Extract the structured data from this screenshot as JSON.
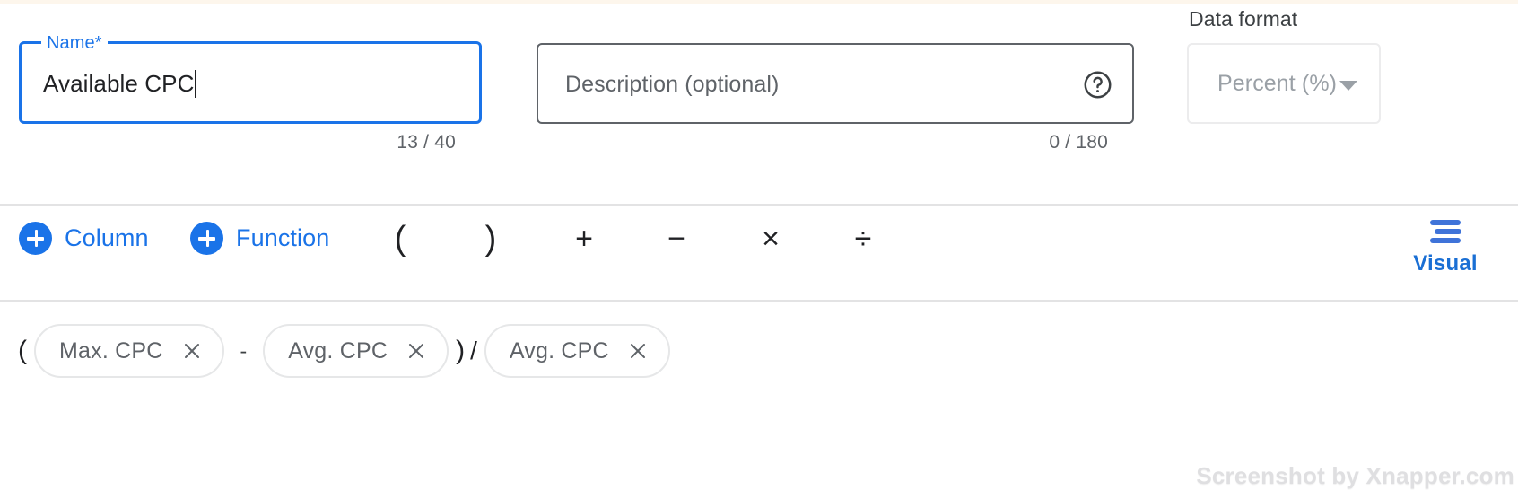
{
  "colors": {
    "accent_blue": "#1a73e8",
    "text_primary": "#202124",
    "text_secondary": "#5f6368",
    "border_grey": "#e6e7e8",
    "divider": "#e3e3e4",
    "disabled_text": "#9aa0a6",
    "top_strip": "#fdf6ec"
  },
  "name_field": {
    "label": "Name*",
    "value": "Available CPC",
    "counter": "13 / 40"
  },
  "description_field": {
    "placeholder": "Description (optional)",
    "value": "",
    "counter": "0 / 180",
    "help_icon": "help-circle-icon"
  },
  "data_format": {
    "label": "Data format",
    "selected": "Percent (%)",
    "dropdown_icon": "chevron-down-icon"
  },
  "toolbar": {
    "add_column": {
      "label": "Column",
      "icon": "plus-circle-icon"
    },
    "add_function": {
      "label": "Function",
      "icon": "plus-circle-icon"
    },
    "operators": [
      {
        "name": "open-paren",
        "glyph": "("
      },
      {
        "name": "close-paren",
        "glyph": ")"
      },
      {
        "name": "plus",
        "glyph": "+"
      },
      {
        "name": "minus",
        "glyph": "−"
      },
      {
        "name": "multiply",
        "glyph": "×"
      },
      {
        "name": "divide",
        "glyph": "÷"
      }
    ],
    "visual_toggle": {
      "label": "Visual",
      "icon": "text-align-bars-icon"
    }
  },
  "formula": {
    "tokens": [
      {
        "type": "paren",
        "text": "("
      },
      {
        "type": "chip",
        "text": "Max. CPC",
        "remove_icon": "close-icon"
      },
      {
        "type": "operator",
        "text": "-"
      },
      {
        "type": "chip",
        "text": "Avg. CPC",
        "remove_icon": "close-icon"
      },
      {
        "type": "paren",
        "text": ")"
      },
      {
        "type": "operator-divide",
        "text": "/"
      },
      {
        "type": "chip",
        "text": "Avg. CPC",
        "remove_icon": "close-icon"
      }
    ]
  },
  "watermark": {
    "text": "Screenshot by Xnapper.com"
  }
}
